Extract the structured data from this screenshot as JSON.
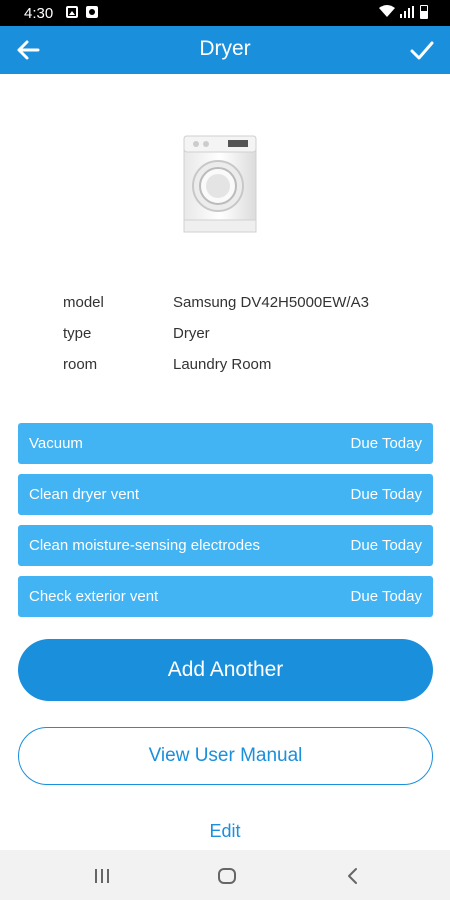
{
  "status_bar": {
    "time": "4:30",
    "icons": [
      "gallery-icon",
      "app-notification-icon",
      "wifi-icon",
      "signal-icon",
      "battery-icon"
    ]
  },
  "app_bar": {
    "title": "Dryer",
    "back_icon": "arrow-left-icon",
    "confirm_icon": "check-icon",
    "background": "#1a8fdc"
  },
  "appliance_image": "dryer-image",
  "details": [
    {
      "label": "model",
      "value": "Samsung DV42H5000EW/A3"
    },
    {
      "label": "type",
      "value": "Dryer"
    },
    {
      "label": "room",
      "value": "Laundry Room"
    }
  ],
  "tasks": [
    {
      "name": "Vacuum",
      "due": "Due Today"
    },
    {
      "name": "Clean dryer vent",
      "due": "Due Today"
    },
    {
      "name": "Clean moisture-sensing electrodes",
      "due": "Due Today"
    },
    {
      "name": "Check exterior vent",
      "due": "Due Today"
    }
  ],
  "buttons": {
    "add_another": "Add Another",
    "view_user_manual": "View User Manual",
    "edit": "Edit"
  },
  "colors": {
    "primary": "#1a8fdc",
    "task_background": "#42b3f3"
  },
  "nav_bar": {
    "icons": [
      "recent-apps-icon",
      "home-icon",
      "back-icon"
    ]
  }
}
